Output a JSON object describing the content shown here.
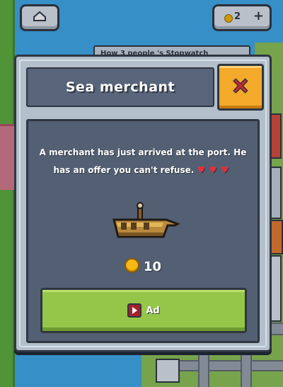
{
  "hud": {
    "home_icon": "home-icon",
    "coins": "2",
    "coins_plus": "+"
  },
  "background": {
    "banner_text": "How 3 people 's Stopwatch"
  },
  "modal": {
    "title": "Sea merchant",
    "close_symbol": "✕",
    "description": "A merchant has just arrived at the port. He has an offer you can't refuse.",
    "hearts": "♥♥♥",
    "price": "10",
    "ad_button_label": "Ad"
  },
  "colors": {
    "panel": "#535f73",
    "close": "#f3a92a",
    "ad_button": "#95c64a",
    "coin": "#f6b817",
    "heart": "#e0303c"
  }
}
